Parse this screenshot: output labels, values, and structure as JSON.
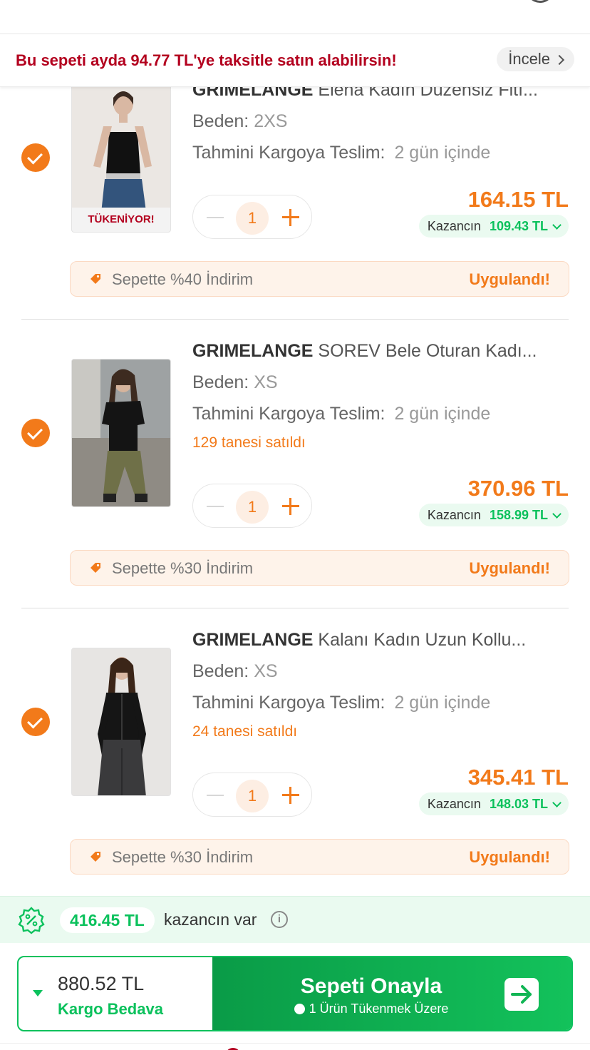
{
  "banner": {
    "installment_text": "Bu sepeti ayda 94.77 TL'ye taksitle satın alabilirsin!",
    "review_label": "İncele"
  },
  "labels": {
    "size_label": "Beden:",
    "delivery_label": "Tahmini Kargoya Teslim:",
    "savings_label": "Kazancın",
    "applied_label": "Uygulandı!"
  },
  "items": [
    {
      "brand": "GRIMELANGE",
      "name": "Elena Kadın Düzensiz Fitı...",
      "size": "2XS",
      "delivery": "2 gün içinde",
      "sold": "",
      "stock_badge": "TÜKENİYOR!",
      "quantity": "1",
      "price": "164.15 TL",
      "savings": "109.43 TL",
      "discount": "Sepette %40 İndirim",
      "checked": true
    },
    {
      "brand": "GRIMELANGE",
      "name": "SOREV Bele Oturan Kadı...",
      "size": "XS",
      "delivery": "2 gün içinde",
      "sold": "129 tanesi satıldı",
      "stock_badge": "",
      "quantity": "1",
      "price": "370.96 TL",
      "savings": "158.99 TL",
      "discount": "Sepette %30 İndirim",
      "checked": true
    },
    {
      "brand": "GRIMELANGE",
      "name": "Kalanı Kadın Uzun Kollu...",
      "size": "XS",
      "delivery": "2 gün içinde",
      "sold": "24 tanesi satıldı",
      "stock_badge": "",
      "quantity": "1",
      "price": "345.41 TL",
      "savings": "148.03 TL",
      "discount": "Sepette %30 İndirim",
      "checked": true
    }
  ],
  "summary": {
    "total_savings": "416.45 TL",
    "savings_text": "kazancın var",
    "info_icon": "info-icon"
  },
  "checkout": {
    "total": "880.52 TL",
    "shipping": "Kargo Bedava",
    "confirm_label": "Sepeti Onayla",
    "confirm_sub": "1 Ürün Tükenmek Üzere"
  },
  "colors": {
    "brand_orange": "#f27a1a",
    "success_green": "#0bc15c",
    "banner_red": "#b3001e"
  }
}
